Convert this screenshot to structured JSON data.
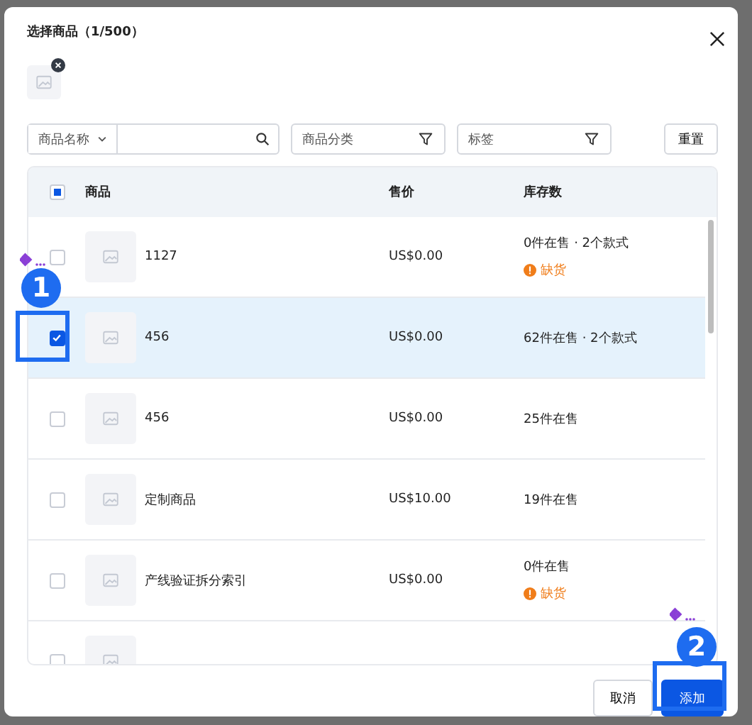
{
  "dialog": {
    "title": "选择商品（1/500）"
  },
  "selected_products": [
    {
      "removable": true
    }
  ],
  "search": {
    "field_label": "商品名称"
  },
  "filters": [
    {
      "placeholder": "商品分类"
    },
    {
      "placeholder": "标签"
    }
  ],
  "reset_button": "重置",
  "table": {
    "header_checkbox": {
      "indeterminate": true
    },
    "columns": [
      "商品",
      "售价",
      "库存数"
    ],
    "rows": [
      {
        "name": "1127",
        "price": "US$0.00",
        "stock": "0件在售 · 2个款式",
        "warning": "缺货",
        "checked": false,
        "selected": false
      },
      {
        "name": "456",
        "price": "US$0.00",
        "stock": "62件在售 · 2个款式",
        "checked": true,
        "selected": true
      },
      {
        "name": "456",
        "price": "US$0.00",
        "stock": "25件在售",
        "checked": false,
        "selected": false
      },
      {
        "name": "定制商品",
        "price": "US$10.00",
        "stock": "19件在售",
        "checked": false,
        "selected": false
      },
      {
        "name": "产线验证拆分索引",
        "price": "US$0.00",
        "stock": "0件在售",
        "warning": "缺货",
        "checked": false,
        "selected": false
      },
      {
        "checked": false,
        "selected": false
      }
    ]
  },
  "footer_buttons": [
    {
      "label": "取消",
      "kind": "secondary"
    },
    {
      "label": "添加",
      "kind": "primary"
    }
  ],
  "annotations": [
    {
      "label": "1"
    },
    {
      "label": "2"
    }
  ]
}
